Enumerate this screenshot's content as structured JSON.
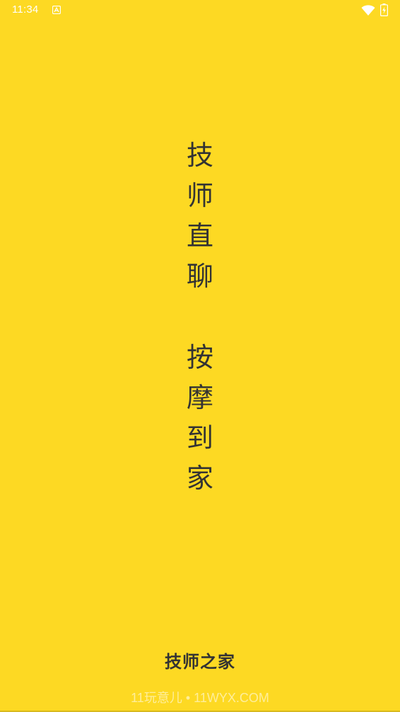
{
  "status_bar": {
    "time": "11:34",
    "app_icon": "android-notification-icon",
    "wifi_icon": "wifi-icon",
    "battery_icon": "battery-charging-icon",
    "text_color": "#ffffff"
  },
  "background_color": "#FDD923",
  "slogan": {
    "line1": [
      "技",
      "师",
      "直",
      "聊"
    ],
    "line2": [
      "按",
      "摩",
      "到",
      "家"
    ]
  },
  "brand_name": "技师之家",
  "watermark": "11玩意儿 • 11WYX.COM"
}
